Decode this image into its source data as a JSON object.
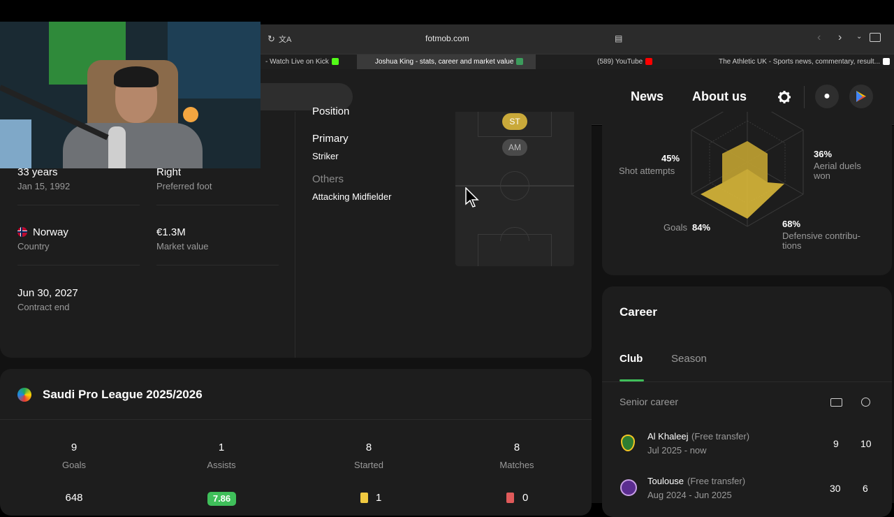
{
  "browser": {
    "url": "fotmob.com",
    "tabs": [
      {
        "label": "- Watch Live on Kick",
        "icon": "kick-icon"
      },
      {
        "label": "Joshua King - stats, career and market value",
        "icon": "fotmob-icon"
      },
      {
        "label": "(589) YouTube",
        "icon": "youtube-icon"
      },
      {
        "label": "The Athletic UK - Sports news, commentary, result...",
        "icon": "athletic-icon"
      }
    ]
  },
  "header": {
    "nav_news": "News",
    "nav_about": "About us"
  },
  "player_info": {
    "position_heading": "Position",
    "age_value": "33 years",
    "age_sub": "Jan 15, 1992",
    "foot_value": "Right",
    "foot_sub": "Preferred foot",
    "country_value": "Norway",
    "country_sub": "Country",
    "market_value": "€1.3M",
    "market_sub": "Market value",
    "contract_value": "Jun 30, 2027",
    "contract_sub": "Contract end",
    "primary_label": "Primary",
    "primary_value": "Striker",
    "others_label": "Others",
    "others_value": "Attacking Midfielder",
    "pitch_primary": "ST",
    "pitch_secondary": "AM"
  },
  "radar": {
    "shot_pct": "45%",
    "shot_label": "Shot attempts",
    "aerial_pct": "36%",
    "aerial_label1": "Aerial duels",
    "aerial_label2": "won",
    "goals_label": "Goals",
    "goals_pct": "84%",
    "def_pct": "68%",
    "def_label1": "Defensive contribu-",
    "def_label2": "tions",
    "colors": {
      "fill": "#d9b83a"
    }
  },
  "season": {
    "league": "Saudi Pro League 2025/2026",
    "stats": [
      {
        "value": "9",
        "label": "Goals"
      },
      {
        "value": "1",
        "label": "Assists"
      },
      {
        "value": "8",
        "label": "Started"
      },
      {
        "value": "8",
        "label": "Matches"
      }
    ],
    "row2": {
      "minutes": "648",
      "rating": "7.86",
      "yellow": "1",
      "red": "0"
    }
  },
  "career": {
    "title": "Career",
    "tab_club": "Club",
    "tab_season": "Season",
    "section": "Senior career",
    "entries": [
      {
        "club": "Al Khaleej",
        "note": "(Free transfer)",
        "period": "Jul 2025 - now",
        "apps": "9",
        "goals": "10"
      },
      {
        "club": "Toulouse",
        "note": "(Free transfer)",
        "period": "Aug 2024 - Jun 2025",
        "apps": "30",
        "goals": "6"
      }
    ]
  }
}
